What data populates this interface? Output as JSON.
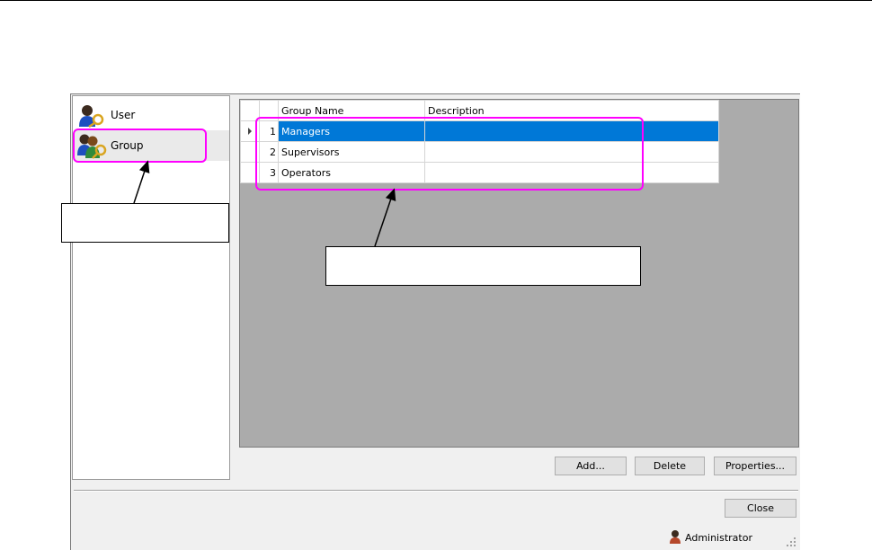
{
  "nav": {
    "items": [
      {
        "label": "User",
        "icon": "user-key-icon"
      },
      {
        "label": "Group",
        "icon": "group-key-icon"
      }
    ],
    "selected": "Group"
  },
  "grid": {
    "columns": [
      "",
      "Group Name",
      "Description"
    ],
    "rows": [
      {
        "num": "1",
        "name": "Managers",
        "description": "",
        "selected": true
      },
      {
        "num": "2",
        "name": "Supervisors",
        "description": "",
        "selected": false
      },
      {
        "num": "3",
        "name": "Operators",
        "description": "",
        "selected": false
      }
    ]
  },
  "buttons": {
    "add": "Add...",
    "delete": "Delete",
    "properties": "Properties...",
    "close": "Close"
  },
  "status": {
    "user": "Administrator"
  },
  "colors": {
    "selection": "#0078d7",
    "callout": "#ff00ff",
    "grid_background": "#ababab"
  }
}
